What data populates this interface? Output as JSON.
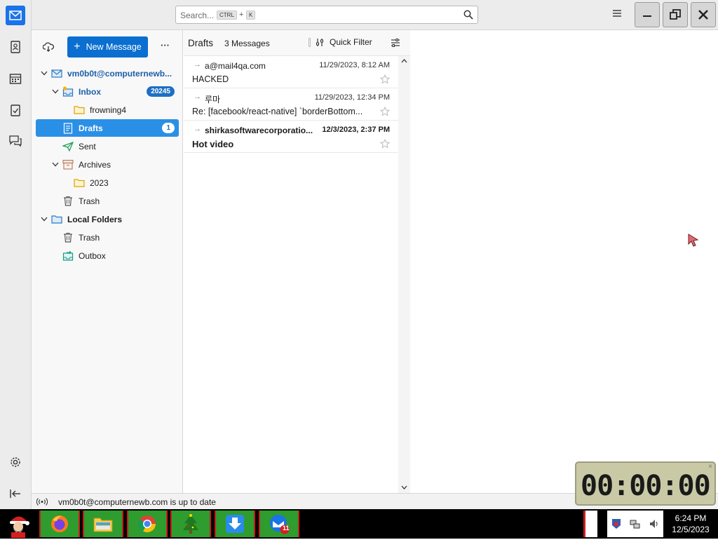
{
  "search": {
    "placeholder": "Search...",
    "kbd_ctrl": "CTRL",
    "kbd_plus": "+",
    "kbd_k": "K"
  },
  "folder_pane": {
    "new_message_label": "New Message",
    "more_label": "···",
    "folders": [
      {
        "label": "vm0b0t@computernewb...",
        "badge": ""
      },
      {
        "label": "Inbox",
        "badge": "20245"
      },
      {
        "label": "frowning4",
        "badge": ""
      },
      {
        "label": "Drafts",
        "badge": "1"
      },
      {
        "label": "Sent",
        "badge": ""
      },
      {
        "label": "Archives",
        "badge": ""
      },
      {
        "label": "2023",
        "badge": ""
      },
      {
        "label": "Trash",
        "badge": ""
      },
      {
        "label": "Local Folders",
        "badge": ""
      },
      {
        "label": "Trash",
        "badge": ""
      },
      {
        "label": "Outbox",
        "badge": ""
      }
    ]
  },
  "thread_pane": {
    "folder_title": "Drafts",
    "count_label": "3 Messages",
    "quick_filter_label": "Quick Filter",
    "messages": [
      {
        "from": "a@mail4qa.com",
        "date": "11/29/2023, 8:12 AM",
        "subject": "HACKED",
        "unread": false
      },
      {
        "from": "루마",
        "date": "11/29/2023, 12:34 PM",
        "subject": "Re: [facebook/react-native] `borderBottom...",
        "unread": false
      },
      {
        "from": "shirkasoftwarecorporatio...",
        "date": "12/3/2023, 2:37 PM",
        "subject": "Hot video",
        "unread": true
      }
    ]
  },
  "status_bar": {
    "text": "vm0b0t@computernewb.com is up to date"
  },
  "timer": {
    "display": "00:00:00"
  },
  "taskbar": {
    "clock_time": "6:24 PM",
    "clock_date": "12/5/2023",
    "thunderbird_badge": "11"
  },
  "colors": {
    "accent": "#0a6fd0",
    "selection": "#2a8fe6",
    "taskbar_green": "#2e9c2e",
    "taskbar_red": "#c81e1e"
  }
}
